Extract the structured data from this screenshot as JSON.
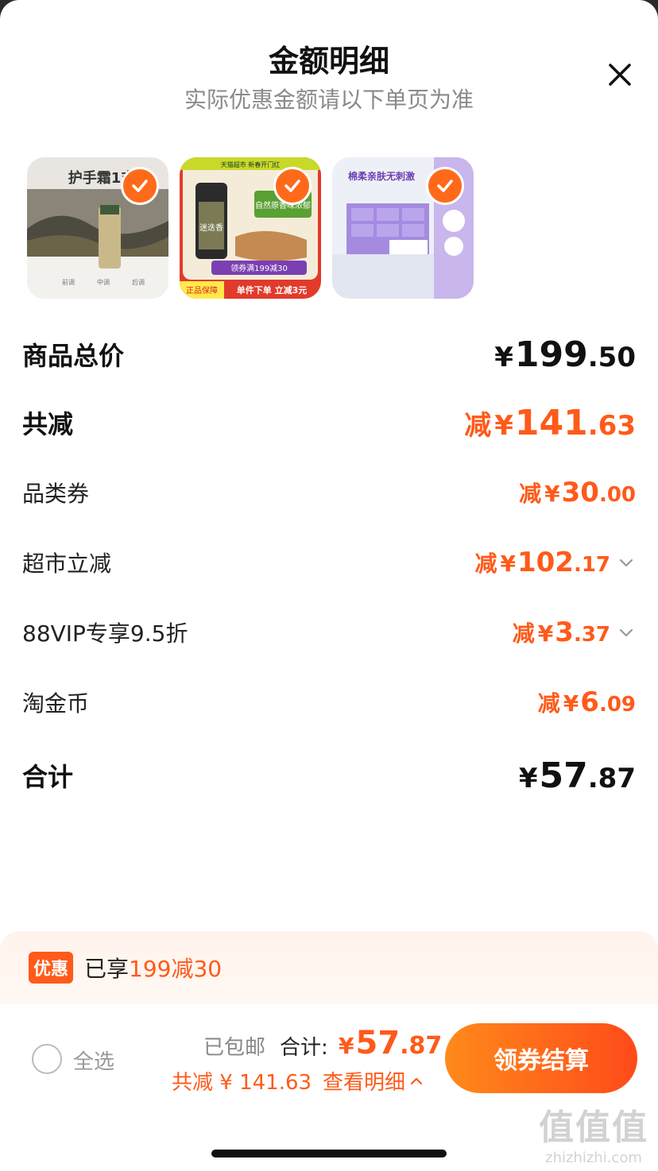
{
  "header": {
    "title": "金额明细",
    "subtitle": "实际优惠金额请以下单页为准",
    "close_icon": "close-icon"
  },
  "products": [
    {
      "name": "hand-cream",
      "selected": true,
      "image_text": "护手霜1支"
    },
    {
      "name": "rosemary-seasoning",
      "selected": true,
      "top_text": "天猫超市 新春开门红",
      "badge_text": "正品保障",
      "coupon_text": "领券满199减30",
      "bottom_text": "单件下单 立减3元",
      "product_text": "迷迭香",
      "tag_text": "自然原香味浓郁"
    },
    {
      "name": "cotton-tissues",
      "selected": true,
      "image_text": "棉柔亲肤无刺激"
    }
  ],
  "breakdown": {
    "goods_total": {
      "label": "商品总价",
      "yen": "¥",
      "int": "199",
      "dec": ".50"
    },
    "total_discount": {
      "label": "共减",
      "prefix": "减",
      "yen": "¥",
      "int": "141",
      "dec": ".63"
    },
    "items": [
      {
        "label": "品类券",
        "prefix": "减",
        "yen": "¥",
        "int": "30",
        "dec": ".00",
        "expandable": false
      },
      {
        "label": "超市立减",
        "prefix": "减",
        "yen": "¥",
        "int": "102",
        "dec": ".17",
        "expandable": true
      },
      {
        "label": "88VIP专享9.5折",
        "prefix": "减",
        "yen": "¥",
        "int": "3",
        "dec": ".37",
        "expandable": true
      },
      {
        "label": "淘金币",
        "prefix": "减",
        "yen": "¥",
        "int": "6",
        "dec": ".09",
        "expandable": false
      }
    ],
    "subtotal": {
      "label": "合计",
      "yen": "¥",
      "int": "57",
      "dec": ".87"
    }
  },
  "promo": {
    "tag": "优惠",
    "text_prefix": "已享",
    "text_highlight": "199减30"
  },
  "footer": {
    "select_all": "全选",
    "shipping": "已包邮",
    "total_label": "合计:",
    "total_yen": "¥",
    "total_int": "57",
    "total_dec": ".87",
    "saved_text": "共减 ¥ 141.63",
    "detail_link": "查看明细",
    "checkout_button": "领券结算"
  },
  "watermark": {
    "logo": "值值值",
    "url": "zhizhizhi.com"
  },
  "colors": {
    "accent": "#ff5a1a",
    "checkout_gradient_start": "#ff8a1a",
    "checkout_gradient_end": "#ff4a1a"
  }
}
